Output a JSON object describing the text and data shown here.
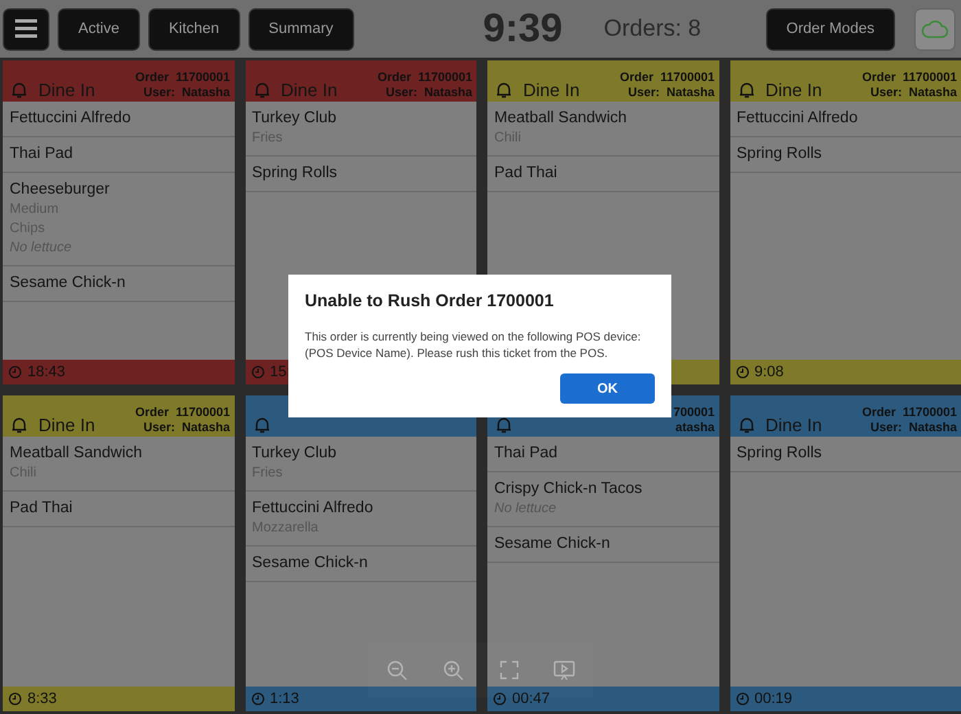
{
  "toolbar": {
    "buttons": [
      {
        "label": "Active"
      },
      {
        "label": "Kitchen"
      },
      {
        "label": "Summary"
      }
    ],
    "clock": "9:39",
    "orders": "Orders: 8",
    "mode_button": "Order Modes"
  },
  "tickets": [
    {
      "color": "#6e2222",
      "type": "Dine In",
      "order": "Order  11700001",
      "user": "User:  Natasha",
      "time": "18:43",
      "items": [
        {
          "name": "Fettuccini Alfredo"
        },
        {
          "name": "Thai Pad"
        },
        {
          "name": "Cheeseburger",
          "mods": [
            {
              "text": "Medium",
              "kind": "modifier"
            },
            {
              "text": "Chips",
              "kind": "modifier"
            },
            {
              "text": "No lettuce",
              "kind": "note"
            }
          ]
        },
        {
          "name": "Sesame Chick-n"
        }
      ]
    },
    {
      "color": "#6e2222",
      "type": "Dine In",
      "order": "Order  11700001",
      "user": "User:  Natasha",
      "time": "15:",
      "items": [
        {
          "name": "Turkey Club",
          "mods": [
            {
              "text": "Fries",
              "kind": "modifier"
            }
          ]
        },
        {
          "name": "Spring Rolls"
        }
      ]
    },
    {
      "color": "#7f7a2a",
      "type": "Dine In",
      "order": "Order  11700001",
      "user": "User:  Natasha",
      "items": [
        {
          "name": "Meatball Sandwich",
          "mods": [
            {
              "text": "Chili",
              "kind": "modifier"
            }
          ]
        },
        {
          "name": "Pad Thai"
        }
      ]
    },
    {
      "color": "#7f7a2a",
      "type": "Dine In",
      "order": "Order  11700001",
      "user": "User:  Natasha",
      "time": "9:08",
      "items": [
        {
          "name": "Fettuccini Alfredo"
        },
        {
          "name": "Spring Rolls"
        }
      ]
    },
    {
      "color": "#7f7a2a",
      "type": "Dine In",
      "order": "Order  11700001",
      "user": "User:  Natasha",
      "time": "8:33",
      "items": [
        {
          "name": "Meatball Sandwich",
          "mods": [
            {
              "text": "Chili",
              "kind": "modifier"
            }
          ]
        },
        {
          "name": "Pad Thai"
        }
      ]
    },
    {
      "color": "#2c5a7e",
      "time": "1:13",
      "items": [
        {
          "name": "Turkey Club",
          "mods": [
            {
              "text": "Fries",
              "kind": "modifier"
            }
          ]
        },
        {
          "name": "Fettuccini Alfredo",
          "mods": [
            {
              "text": "Mozzarella",
              "kind": "modifier"
            }
          ]
        },
        {
          "name": "Sesame Chick-n"
        }
      ]
    },
    {
      "color": "#2c5a7e",
      "order": "700001",
      "user": "atasha",
      "time": "00:47",
      "items": [
        {
          "name": "Thai Pad"
        },
        {
          "name": "Crispy Chick-n Tacos",
          "mods": [
            {
              "text": "No lettuce",
              "kind": "note"
            }
          ]
        },
        {
          "name": "Sesame Chick-n"
        }
      ]
    },
    {
      "color": "#2c5a7e",
      "type": "Dine In",
      "order": "Order  11700001",
      "user": "User:  Natasha",
      "time": "00:19",
      "items": [
        {
          "name": "Spring Rolls"
        }
      ]
    }
  ],
  "dialog": {
    "title": "Unable to Rush Order 1700001",
    "message": "This order is currently being viewed on the following POS device: (POS Device Name). Please rush this ticket from the POS.",
    "button": "OK"
  }
}
